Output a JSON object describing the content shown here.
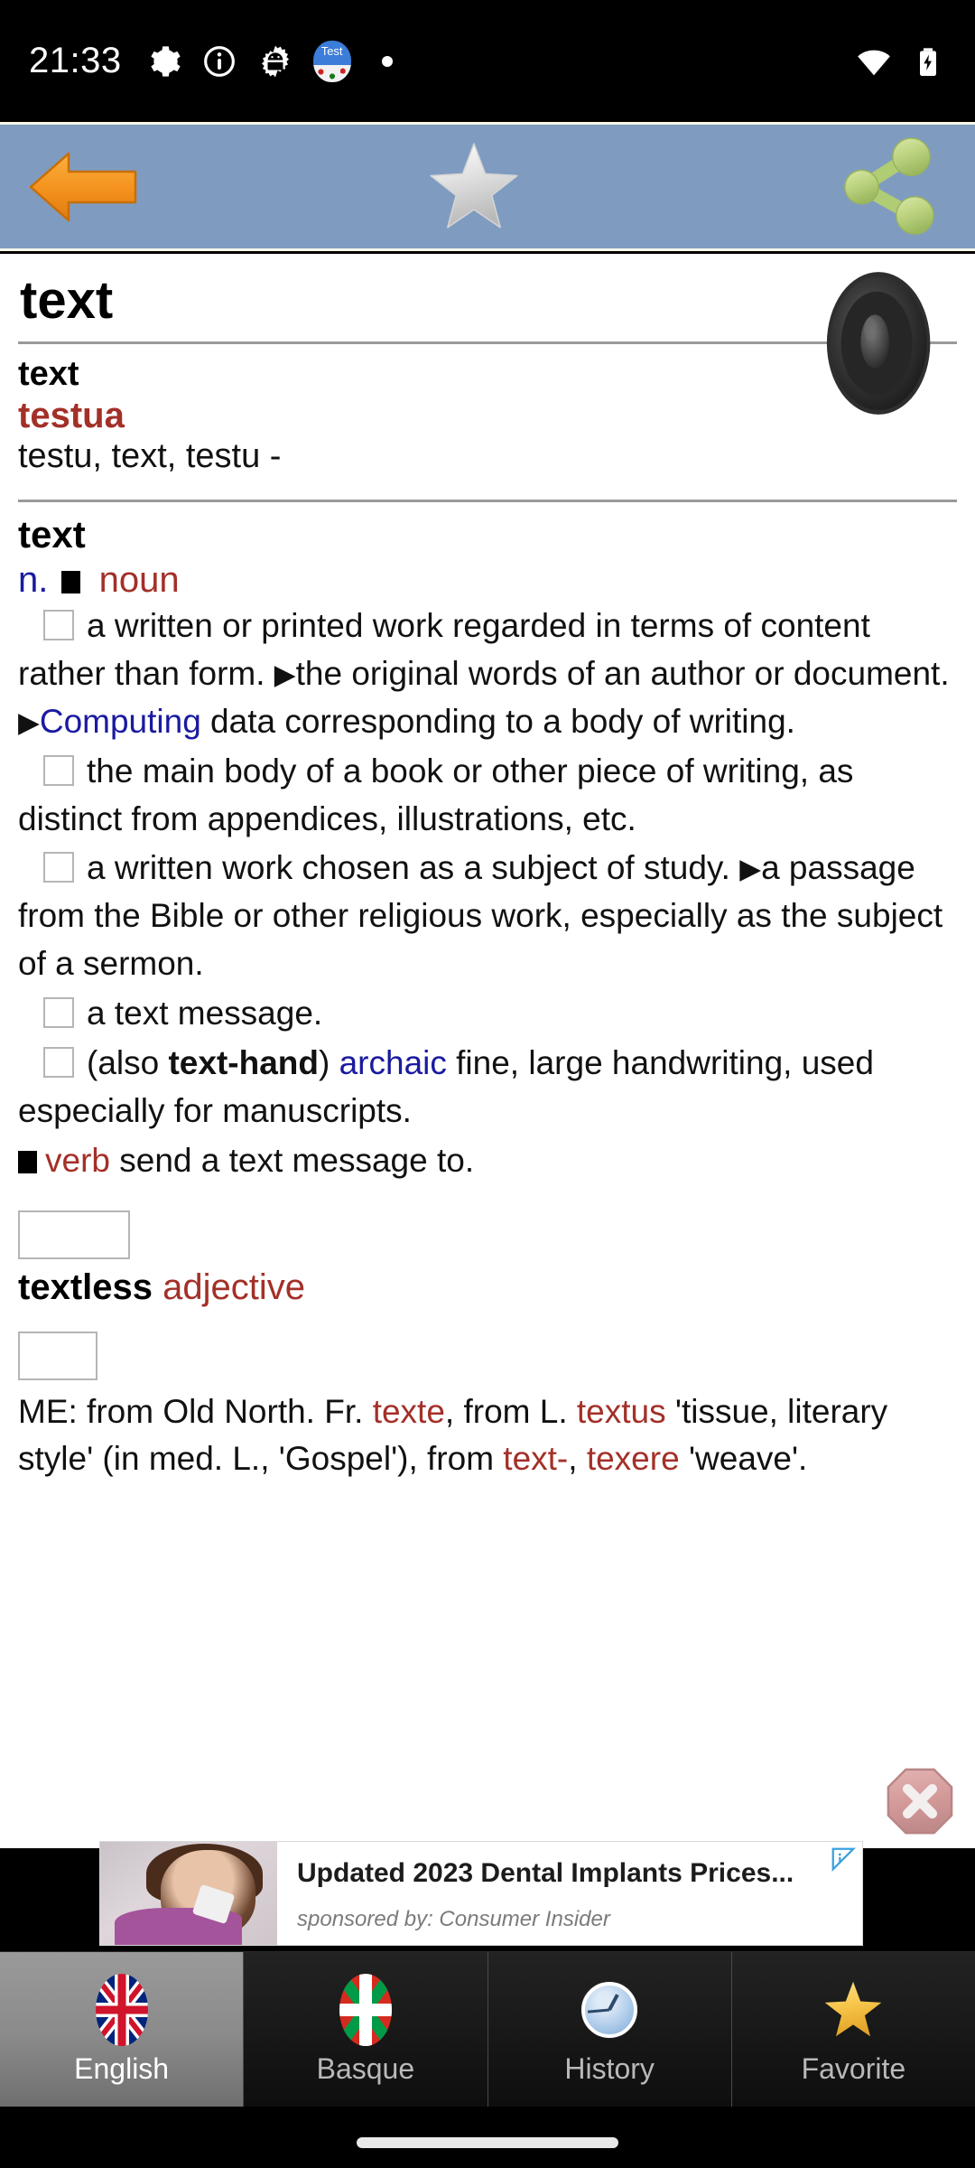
{
  "status_bar": {
    "time": "21:33",
    "icons": [
      "gear-icon",
      "info-icon",
      "android-gear-icon",
      "test-app-icon",
      "dot-icon"
    ],
    "test_app_label": "Test",
    "right_icons": [
      "wifi-icon",
      "battery-charging-icon"
    ]
  },
  "toolbar": {
    "back_label": "Back",
    "favorite_label": "Add to favorites",
    "share_label": "Share",
    "background_color": "#7f9cc0"
  },
  "entry": {
    "headword": "text",
    "speaker_label": "Pronounce",
    "translation": {
      "source": "text",
      "target": "testua",
      "alternatives": "testu, text, testu -"
    },
    "definition": {
      "word": "text",
      "pos_abbrev": "n.",
      "pos_full": "noun",
      "senses": [
        {
          "parts": [
            {
              "t": "a written or printed work regarded in terms of content rather than form. ",
              "style": "plain"
            },
            {
              "t": "▶",
              "style": "tri"
            },
            {
              "t": "the original words of an author or document. ",
              "style": "plain"
            },
            {
              "t": "▶",
              "style": "tri"
            },
            {
              "t": "Computing",
              "style": "blue"
            },
            {
              "t": " data corresponding to a body of writing.",
              "style": "plain"
            }
          ]
        },
        {
          "parts": [
            {
              "t": "the main body of a book or other piece of writing, as distinct from appendices, illustrations, etc.",
              "style": "plain"
            }
          ]
        },
        {
          "parts": [
            {
              "t": "a written work chosen as a subject of study. ",
              "style": "plain"
            },
            {
              "t": "▶",
              "style": "tri"
            },
            {
              "t": "a passage from the Bible or other religious work, especially as the subject of a sermon.",
              "style": "plain"
            }
          ]
        },
        {
          "parts": [
            {
              "t": "a text message.",
              "style": "plain"
            }
          ]
        },
        {
          "parts": [
            {
              "t": "(also ",
              "style": "plain"
            },
            {
              "t": "text-hand",
              "style": "bold"
            },
            {
              "t": ") ",
              "style": "plain"
            },
            {
              "t": "archaic",
              "style": "blue"
            },
            {
              "t": " fine, large handwriting, used especially for manuscripts.",
              "style": "plain"
            }
          ]
        }
      ],
      "verb_section": {
        "label": "verb",
        "text": " send a text message to."
      },
      "derivatives": {
        "word": "textless",
        "pos": "adjective"
      },
      "origin": [
        {
          "t": "ME: from Old North. Fr. ",
          "style": "plain"
        },
        {
          "t": "texte",
          "style": "red"
        },
        {
          "t": ", from L. ",
          "style": "plain"
        },
        {
          "t": "textus",
          "style": "red"
        },
        {
          "t": " 'tissue, literary style' (in med. L., 'Gospel'), from ",
          "style": "plain"
        },
        {
          "t": "text-",
          "style": "red"
        },
        {
          "t": ", ",
          "style": "plain"
        },
        {
          "t": "texere",
          "style": "red"
        },
        {
          "t": " 'weave'.",
          "style": "plain"
        }
      ]
    }
  },
  "ad": {
    "title": "Updated 2023 Dental Implants Prices...",
    "sponsor": "sponsored by: Consumer Insider",
    "close_label": "Close ad",
    "adchoices_label": "AdChoices"
  },
  "bottom_nav": {
    "items": [
      {
        "label": "English",
        "icon": "uk-flag-icon",
        "active": true
      },
      {
        "label": "Basque",
        "icon": "basque-flag-icon",
        "active": false
      },
      {
        "label": "History",
        "icon": "clock-icon",
        "active": false
      },
      {
        "label": "Favorite",
        "icon": "star-icon",
        "active": false
      }
    ]
  },
  "colors": {
    "toolbar_blue": "#7f9cc0",
    "accent_red": "#a33028",
    "link_blue": "#1a1aa0",
    "nav_active_bg": "#8a8a8a"
  }
}
